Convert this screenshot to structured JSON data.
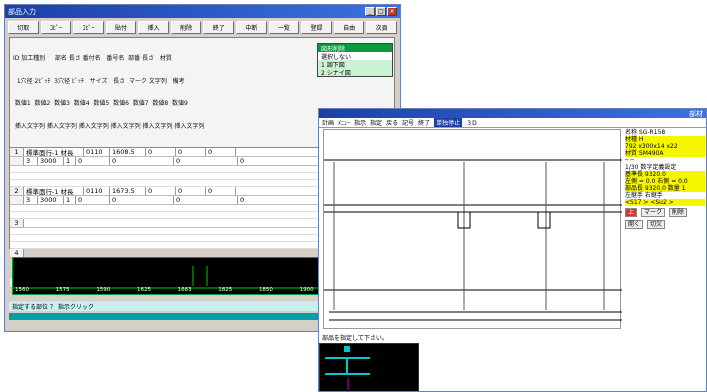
{
  "win1": {
    "title": "部品入力",
    "toolbar": [
      "切取",
      "ｺﾋﾟｰ",
      "ｺﾋﾟｰ",
      "貼付",
      "挿入",
      "削除",
      "終了",
      "中断",
      "一覧",
      "登録",
      "自由",
      "次頁"
    ],
    "header_lines": [
      "ID 加工種別     部名 長さ 番付名   番号名  部番 長さ   材質",
      "  1穴径 2ﾋﾟｯﾁ  3穴径 ﾋﾟｯﾁ   サイズ   長さ  マーク 文字列   備考",
      " 数値1  数値2  数値3  数値4  数値5  数値6  数値7  数値8  数値9",
      " 挿入文字列 挿入文字列 挿入文字列 挿入文字列 挿入文字列 挿入文字列"
    ],
    "records": [
      {
        "num": "1",
        "a": "標準面行-1 材長",
        "b": "0110",
        "c": "1608.5",
        "d": "0",
        "e": "0",
        "f": "0",
        "g": "",
        "sub": [
          "3",
          "3000",
          "1",
          "0",
          "0",
          "0",
          "0",
          "計",
          "算"
        ]
      },
      {
        "num": "2",
        "a": "標準面行-1 材長",
        "b": "0110",
        "c": "1673.5",
        "d": "0",
        "e": "0",
        "f": "0",
        "g": "",
        "sub": [
          "3",
          "3000",
          "1",
          "0",
          "0",
          "0",
          "0",
          "計",
          "算"
        ]
      },
      {
        "num": "3"
      },
      {
        "num": "4"
      },
      {
        "num": "5"
      }
    ],
    "dropdown": [
      "図形削除",
      "選択しない",
      "1 調下図",
      "2 シナイ図"
    ],
    "ruler": [
      "1560",
      "1575",
      "1590",
      "1625",
      "1663",
      "1825",
      "1850",
      "1900",
      "1965",
      "1525"
    ],
    "status": "指定する部位 ？  指示クリック"
  },
  "win2": {
    "title": "部材",
    "menu": [
      "計画",
      "ﾒﾆｭｰ",
      "指示",
      "指定",
      "戻る",
      "記号",
      "終了",
      "単独停止",
      "３D"
    ],
    "selected_menu": "単独停止",
    "props": [
      "名称 SG-R158",
      "材種 H",
      " 792 x300x14 x22",
      "材質 SM490A",
      "  ─   ─",
      " 1/30  数字定義設定",
      "基準長 9320.0",
      "左側 = 0.0 右側 = 0.0",
      "部品長 9320.0 数量  1",
      "左継手   右継手",
      " <S17  > <Su2  >"
    ],
    "tags": [
      "上",
      "マーク",
      "削除"
    ],
    "buttons": [
      "開く",
      "切欠"
    ],
    "prompt": "部品を指定して下さい。"
  },
  "colors": {
    "title": "#1d3fa8",
    "accent": "#0a9a3b",
    "highlight": "#f6f600",
    "canvas": "#000000",
    "cyan": "#00c8d0"
  }
}
